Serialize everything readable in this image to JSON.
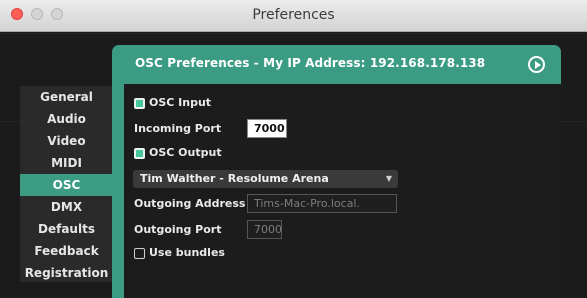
{
  "window": {
    "title": "Preferences"
  },
  "sidebar": {
    "items": [
      {
        "label": "General"
      },
      {
        "label": "Audio"
      },
      {
        "label": "Video"
      },
      {
        "label": "MIDI"
      },
      {
        "label": "OSC",
        "active": true
      },
      {
        "label": "DMX"
      },
      {
        "label": "Defaults"
      },
      {
        "label": "Feedback"
      },
      {
        "label": "Registration"
      }
    ]
  },
  "osc": {
    "title": "OSC Preferences - My IP Address: 192.168.178.138",
    "osc_input_label": "OSC Input",
    "osc_input_checked": true,
    "incoming_port_label": "Incoming Port",
    "incoming_port_value": "7000",
    "osc_output_label": "OSC Output",
    "osc_output_checked": true,
    "output_device": "Tim Walther - Resolume Arena",
    "outgoing_address_label": "Outgoing Address",
    "outgoing_address_placeholder": "Tims-Mac-Pro.local.",
    "outgoing_port_label": "Outgoing Port",
    "outgoing_port_placeholder": "7000",
    "use_bundles_label": "Use bundles",
    "use_bundles_checked": false
  },
  "colors": {
    "accent": "#3b9c83",
    "checkbox_on": "#47c7a0"
  },
  "icons": {
    "play": "play-circle-icon",
    "dropdown": "chevron-down-icon"
  }
}
